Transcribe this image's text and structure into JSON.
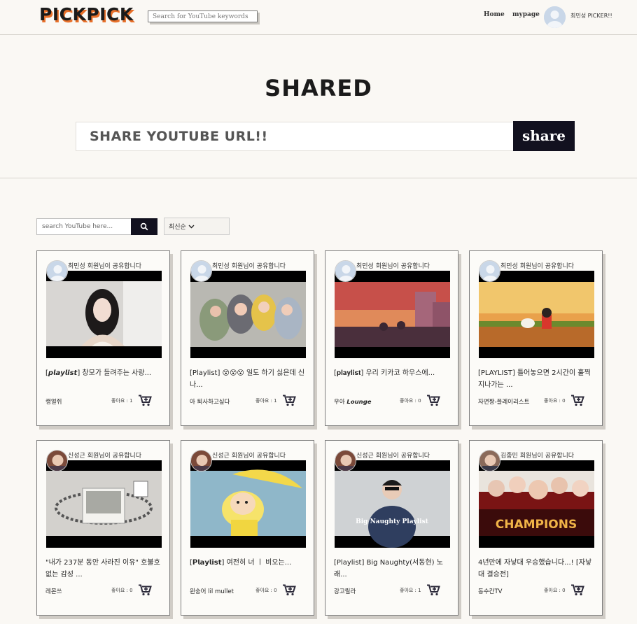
{
  "header": {
    "logo": "PICKPICK",
    "search_placeholder": "Search for YouTube keywords",
    "nav_home": "Home",
    "nav_mypage": "mypage",
    "username": "최민성 PICKER!!"
  },
  "hero": {
    "title": "SHARED",
    "url_placeholder": "SHARE YOUTUBE URL!!",
    "share_button": "share"
  },
  "filter": {
    "search_placeholder": "search YouTube here...",
    "sort_label": "최신순"
  },
  "colors": {
    "accent_orange": "#e8702a",
    "dark_navy": "#12111f",
    "background": "#faf8f4"
  },
  "cards": [
    {
      "sharer": "최민성 회원님이 공유합니다",
      "title": "[𝙥𝙡𝙖𝙮𝙡𝙞𝙨𝙩] 창모가 들려주는 사랑...",
      "channel": "캥얼쥐",
      "likes": "좋아요 : 1"
    },
    {
      "sharer": "최민성 회원님이 공유합니다",
      "title": "[Playlist] 😵😵😵 일도 하기 싫은데 신나...",
      "channel": "아 퇴사하고싶다",
      "likes": "좋아요 : 1"
    },
    {
      "sharer": "최민성 회원님이 공유합니다",
      "title": "[𝐩𝐥𝐚𝐲𝐥𝐢𝐬𝐭] 우리 키카코 하우스에...",
      "channel": "우아 𝙇𝙤𝙪𝙣𝙜𝙚",
      "likes": "좋아요 : 0"
    },
    {
      "sharer": "최민성 회원님이 공유합니다",
      "title": "[PLAYLIST] 틀어놓으면 2시간이 훌쩍 지나가는 ...",
      "channel": "자면짱-플레이리스트",
      "likes": "좋아요 : 0"
    },
    {
      "sharer": "신성근 회원님이 공유합니다",
      "title": "\"내가 237분 동안 사라진 이유\" 호불호 없는 감성 ...",
      "channel": "레몬쓰",
      "likes": "좋아요 : 0"
    },
    {
      "sharer": "신성근 회원님이 공유합니다",
      "title": "[𝗣𝗹𝗮𝘆𝗹𝗶𝘀𝘁] 여전히 너 ㅣ 비오는...",
      "channel": "윈숭어 lil mullet",
      "likes": "좋아요 : 0"
    },
    {
      "sharer": "신성근 회원님이 공유합니다",
      "title": "[Playlist] Big Naughty(서동현) 노래...",
      "channel": "강고릴라",
      "likes": "좋아요 : 1"
    },
    {
      "sharer": "김종민 회원님이 공유합니다",
      "title": "4년만에 자낳대 우승했습니다...! [자낳대 결승전]",
      "channel": "동수칸TV",
      "likes": "좋아요 : 0"
    }
  ],
  "thumb_text": {
    "big_naughty": "Big Naughty Playlist",
    "champions": "CHAMPIONS"
  }
}
